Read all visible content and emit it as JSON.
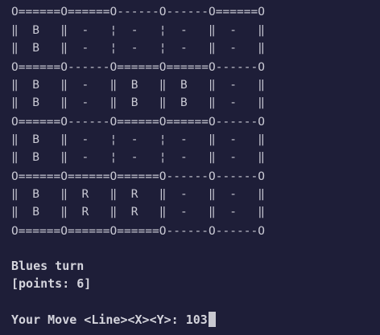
{
  "board": {
    "rows": [
      "O======O======O------O------O======O",
      "‖  B   ‖  -   ¦  -   ¦  -   ‖  -   ‖",
      "‖  B   ‖  -   ¦  -   ¦  -   ‖  -   ‖",
      "O======O------O======O======O------O",
      "‖  B   ‖  -   ‖  B   ‖  B   ‖  -   ‖",
      "‖  B   ‖  -   ‖  B   ‖  B   ‖  -   ‖",
      "O======O------O======O======O------O",
      "‖  B   ‖  -   ¦  -   ¦  -   ‖  -   ‖",
      "‖  B   ‖  -   ¦  -   ¦  -   ‖  -   ‖",
      "O======O======O======O------O------O",
      "‖  B   ‖  R   ‖  R   ‖  -   ‖  -   ‖",
      "‖  B   ‖  R   ‖  R   ‖  -   ‖  -   ‖",
      "O======O======O======O------O------O"
    ]
  },
  "status": {
    "turn": "Blues turn",
    "points": "[points: 6]"
  },
  "prompt": {
    "label": "Your Move <Line><X><Y>: ",
    "input_value": "103"
  }
}
